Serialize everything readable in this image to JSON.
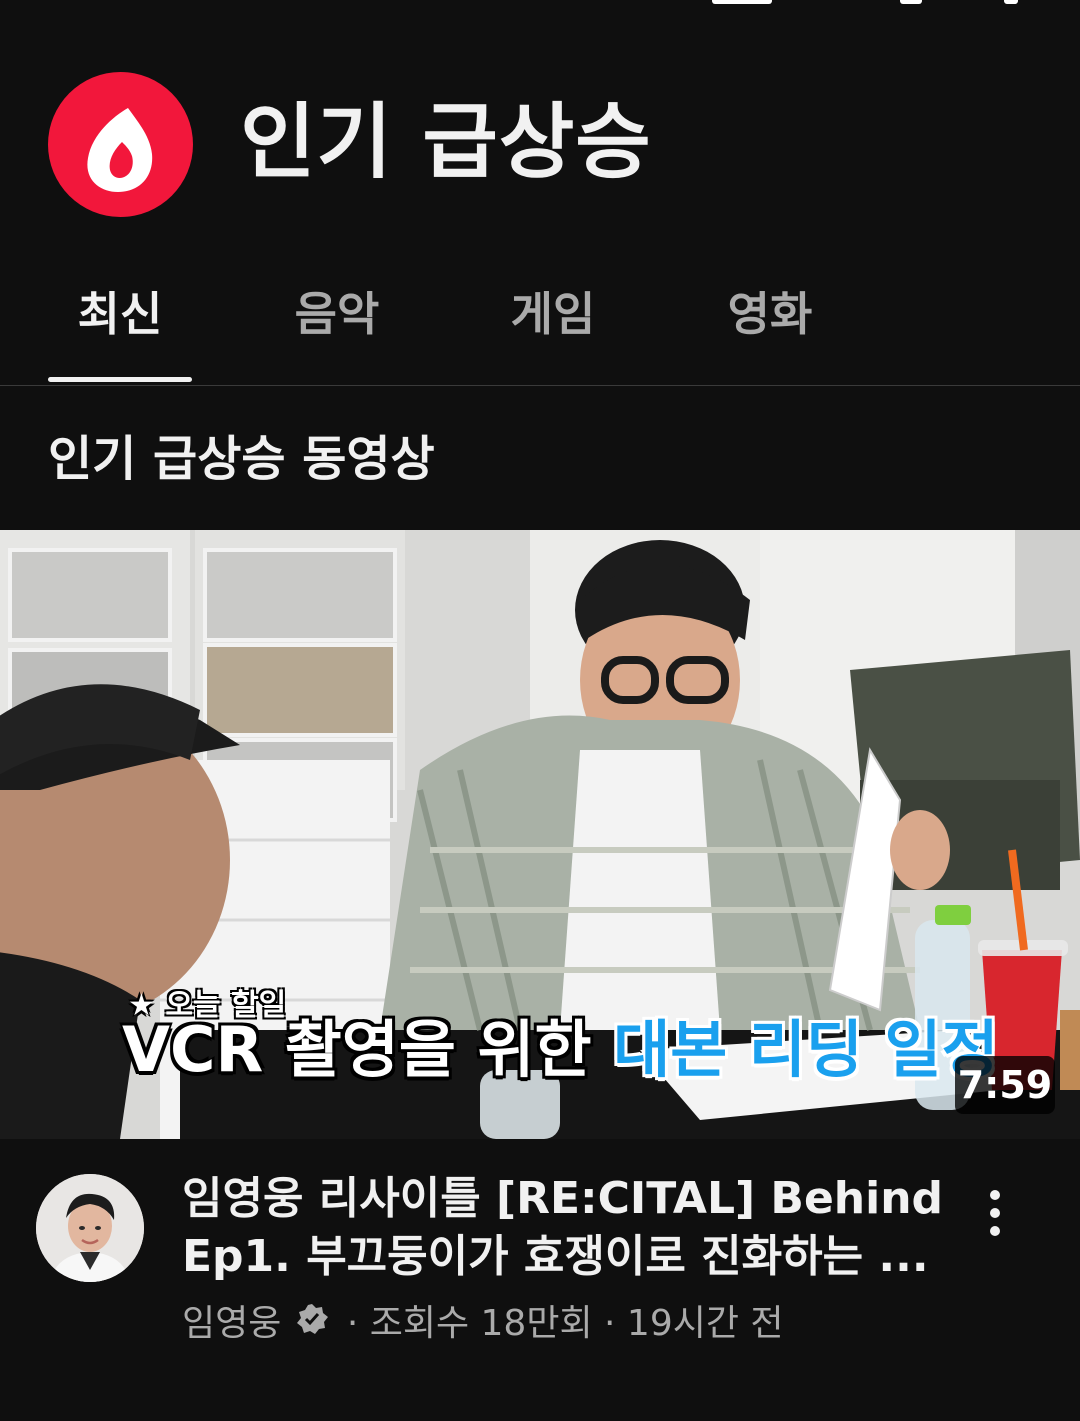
{
  "header": {
    "title": "인기 급상승",
    "logo_icon": "trending-flame-icon",
    "logo_color": "#f2173b"
  },
  "tabs": [
    {
      "label": "최신",
      "active": true
    },
    {
      "label": "음악",
      "active": false
    },
    {
      "label": "게임",
      "active": false
    },
    {
      "label": "영화",
      "active": false
    }
  ],
  "section": {
    "title": "인기 급상승 동영상"
  },
  "video": {
    "thumbnail": {
      "caption_small": "★ 오늘 할일",
      "caption_part1": "VCR 촬영을 위한 ",
      "caption_part2": "대본 리딩 일정",
      "caption_highlight_color": "#1aa0ee"
    },
    "duration": "7:59",
    "title_line1": "임영웅 리사이틀 [RE:CITAL] Behind",
    "title_line2": "Ep1. 부끄둥이가 효쟁이로 진화하는 ...",
    "channel": "임영웅",
    "verified_icon": "verified-badge-icon",
    "separator": " · ",
    "views": "조회수 18만회",
    "age": "19시간 전",
    "more_icon": "more-vertical-icon"
  },
  "colors": {
    "background": "#0f0f0f",
    "text_primary": "#f1f1f1",
    "text_secondary": "#aaaaaa"
  }
}
